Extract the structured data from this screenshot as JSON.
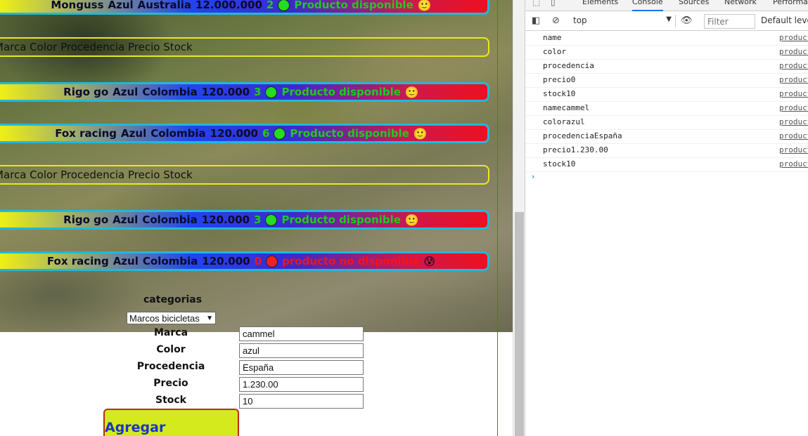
{
  "products": {
    "rows": [
      {
        "type": "product",
        "marca": "Monguss",
        "color": "Azul",
        "procedencia": "Australia",
        "precio": "12.000.000",
        "stock": "2",
        "available": true,
        "status": "Producto disponible",
        "emoji": "🙂"
      },
      {
        "type": "header",
        "text": "Marca Color Procedencia Precio Stock"
      },
      {
        "type": "product",
        "marca": "Rigo go",
        "color": "Azul",
        "procedencia": "Colombia",
        "precio": "120.000",
        "stock": "3",
        "available": true,
        "status": "Producto disponible",
        "emoji": "🙂"
      },
      {
        "type": "product",
        "marca": "Fox racing",
        "color": "Azul",
        "procedencia": "Colombia",
        "precio": "120.000",
        "stock": "6",
        "available": true,
        "status": "Producto disponible",
        "emoji": "🙂"
      },
      {
        "type": "header",
        "text": "Marca Color Procedencia Precio Stock"
      },
      {
        "type": "product",
        "marca": "Rigo go",
        "color": "Azul",
        "procedencia": "Colombia",
        "precio": "120.000",
        "stock": "3",
        "available": true,
        "status": "Producto disponible",
        "emoji": "🙂"
      },
      {
        "type": "product",
        "marca": "Fox racing",
        "color": "Azul",
        "procedencia": "Colombia",
        "precio": "120.000",
        "stock": "0",
        "available": false,
        "status": "producto no disponible",
        "emoji": "😰"
      }
    ]
  },
  "form": {
    "categories_label": "categorias",
    "category_selected": "Marcos bicicletas",
    "fields": [
      {
        "label": "Marca",
        "value": "cammel"
      },
      {
        "label": "Color",
        "value": "azul"
      },
      {
        "label": "Procedencia",
        "value": "España"
      },
      {
        "label": "Precio",
        "value": "1.230.00"
      },
      {
        "label": "Stock",
        "value": "10"
      }
    ],
    "submit_label": "Agregar producto"
  },
  "devtools": {
    "tabs": [
      "Elements",
      "Console",
      "Sources",
      "Network",
      "Performan"
    ],
    "active_tab": "Console",
    "context": "top",
    "filter_placeholder": "Filter",
    "levels_label": "Default levels",
    "source_link": "product",
    "log": [
      "name",
      "color",
      "procedencia",
      "precio0",
      "stock10",
      "namecammel",
      "colorazul",
      "procedenciaEspaña",
      "precio1.230.00",
      "stock10"
    ],
    "prompt": "›",
    "icons": {
      "inspect": "inspect-icon",
      "device": "device-toggle-icon",
      "sidebar": "sidebar-toggle-icon",
      "clear": "clear-console-icon",
      "eye": "live-expression-icon"
    }
  }
}
